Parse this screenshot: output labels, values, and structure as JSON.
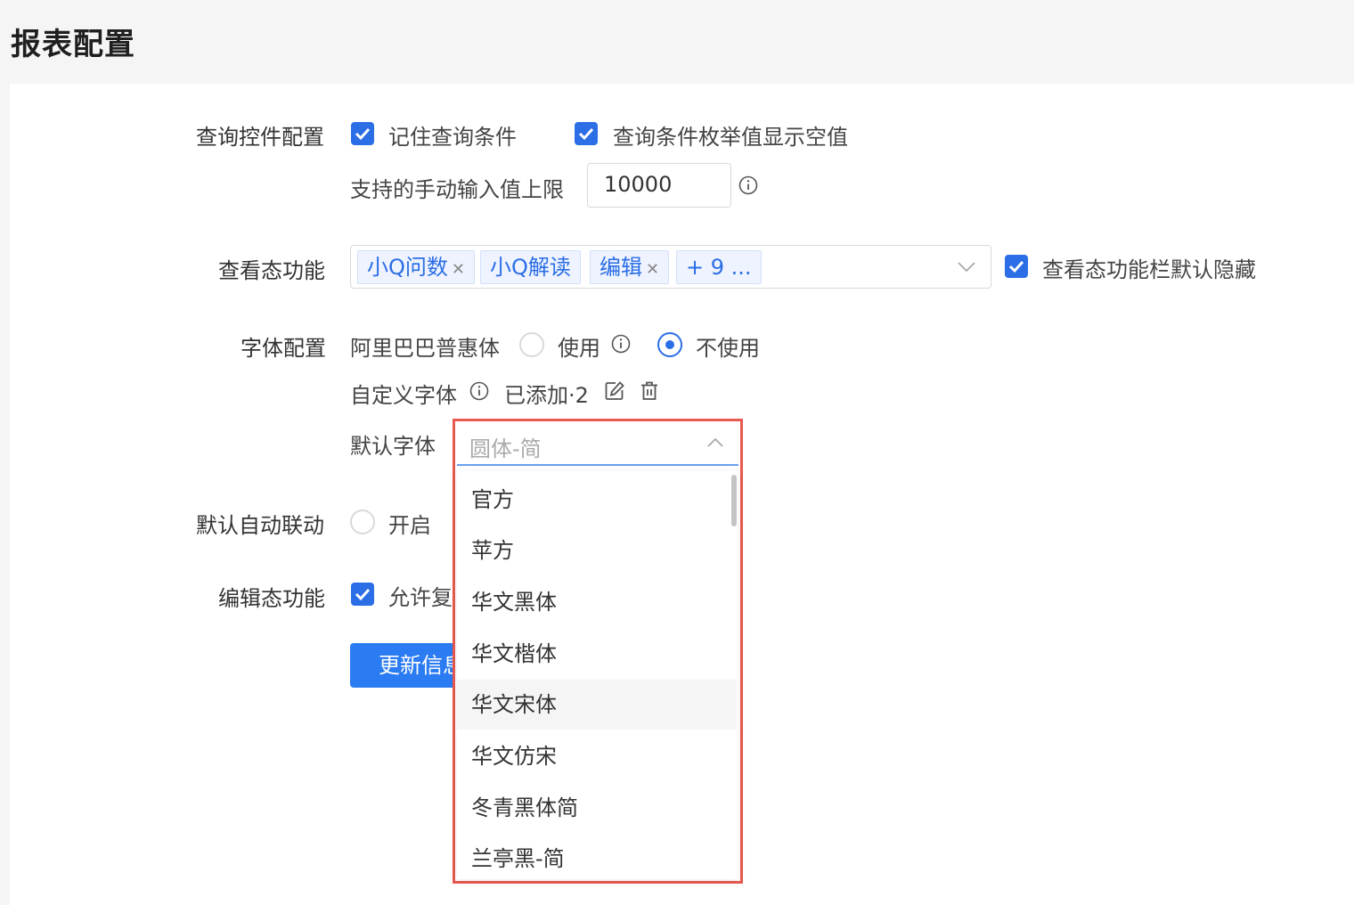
{
  "page": {
    "title": "报表配置"
  },
  "query_control": {
    "label": "查询控件配置",
    "remember_label": "记住查询条件",
    "remember_checked": true,
    "enum_empty_label": "查询条件枚举值显示空值",
    "enum_empty_checked": true,
    "manual_limit_label": "支持的手动输入值上限",
    "manual_limit_value": "10000"
  },
  "view_functions": {
    "label": "查看态功能",
    "tags": [
      {
        "label": "小Q问数",
        "closable": true
      },
      {
        "label": "小Q解读",
        "closable": false
      },
      {
        "label": "编辑",
        "closable": true
      },
      {
        "label": "+ 9 ...",
        "closable": false
      }
    ],
    "hide_default_label": "查看态功能栏默认隐藏",
    "hide_default_checked": true
  },
  "font_config": {
    "label": "字体配置",
    "alibaba_label": "阿里巴巴普惠体",
    "use_label": "使用",
    "not_use_label": "不使用",
    "selected": "不使用",
    "custom_font_label": "自定义字体",
    "added_label": "已添加·2",
    "default_font_label": "默认字体",
    "default_font_value": "圆体-简",
    "options": [
      "官方",
      "苹方",
      "华文黑体",
      "华文楷体",
      "华文宋体",
      "华文仿宋",
      "冬青黑体简",
      "兰亭黑-简"
    ],
    "hovered_option": "华文宋体"
  },
  "auto_linkage": {
    "label": "默认自动联动",
    "open_label": "开启",
    "open_selected": false
  },
  "edit_functions": {
    "label": "编辑态功能",
    "allow_label": "允许复",
    "allow_checked": true
  },
  "actions": {
    "update_label": "更新信息"
  },
  "colors": {
    "primary": "#2b6ee6",
    "highlight_border": "#e8594f"
  }
}
